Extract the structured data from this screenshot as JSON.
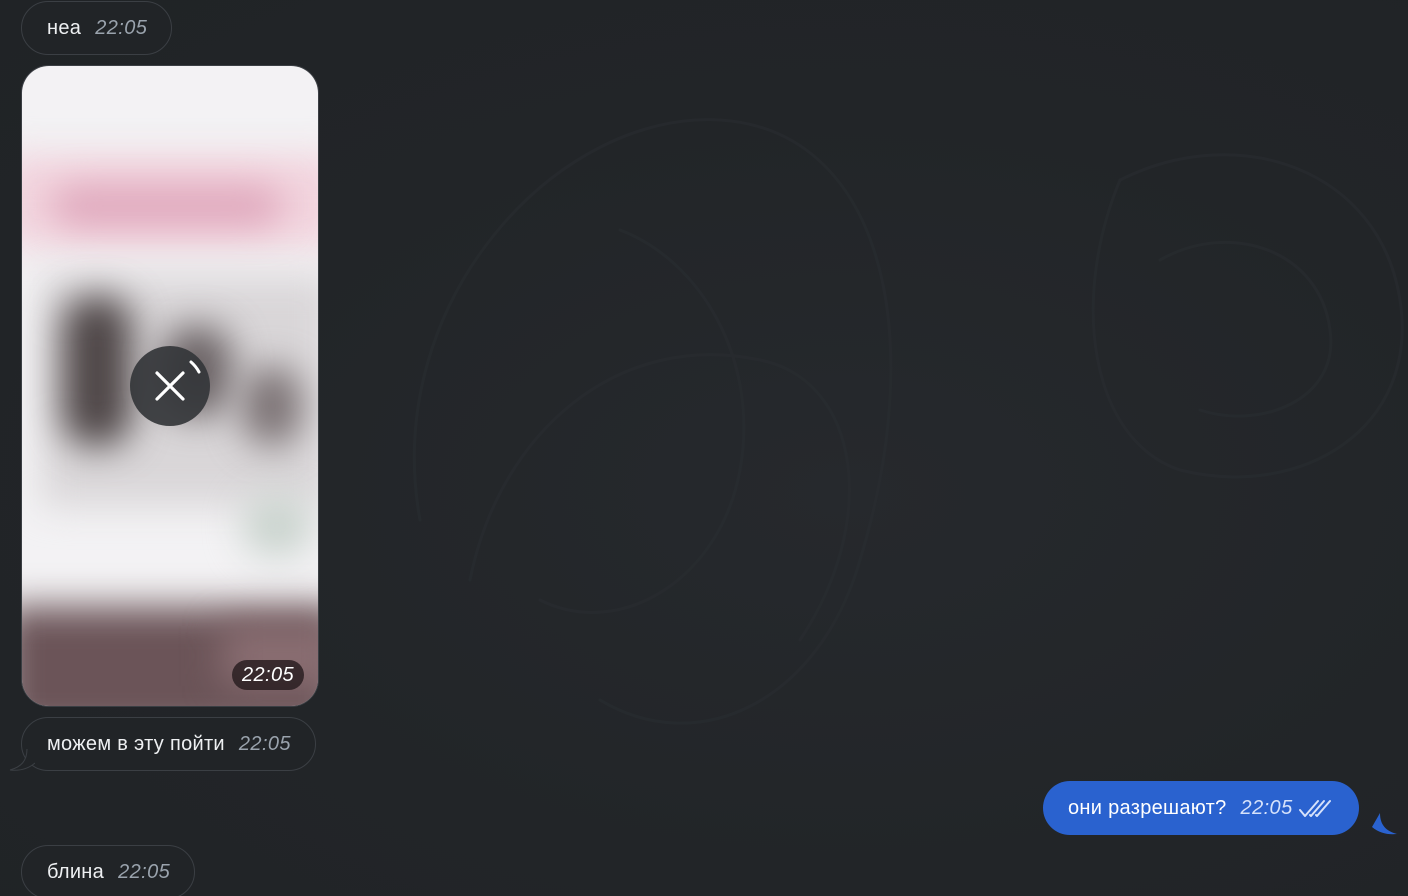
{
  "messages": [
    {
      "text": "неа",
      "time": "22:05"
    },
    {
      "time": "22:05"
    },
    {
      "text": "можем в эту пойти",
      "time": "22:05"
    },
    {
      "text": "они разрешают?",
      "time": "22:05"
    },
    {
      "text": "блина",
      "time": "22:05"
    }
  ],
  "colors": {
    "background": "#22262a",
    "incoming_bubble": "#212427",
    "outgoing_bubble": "#2a62cf",
    "timestamp": "#9aa3ad"
  },
  "icons": {
    "cancel": "close-icon",
    "read_status": "double-check-icon"
  }
}
